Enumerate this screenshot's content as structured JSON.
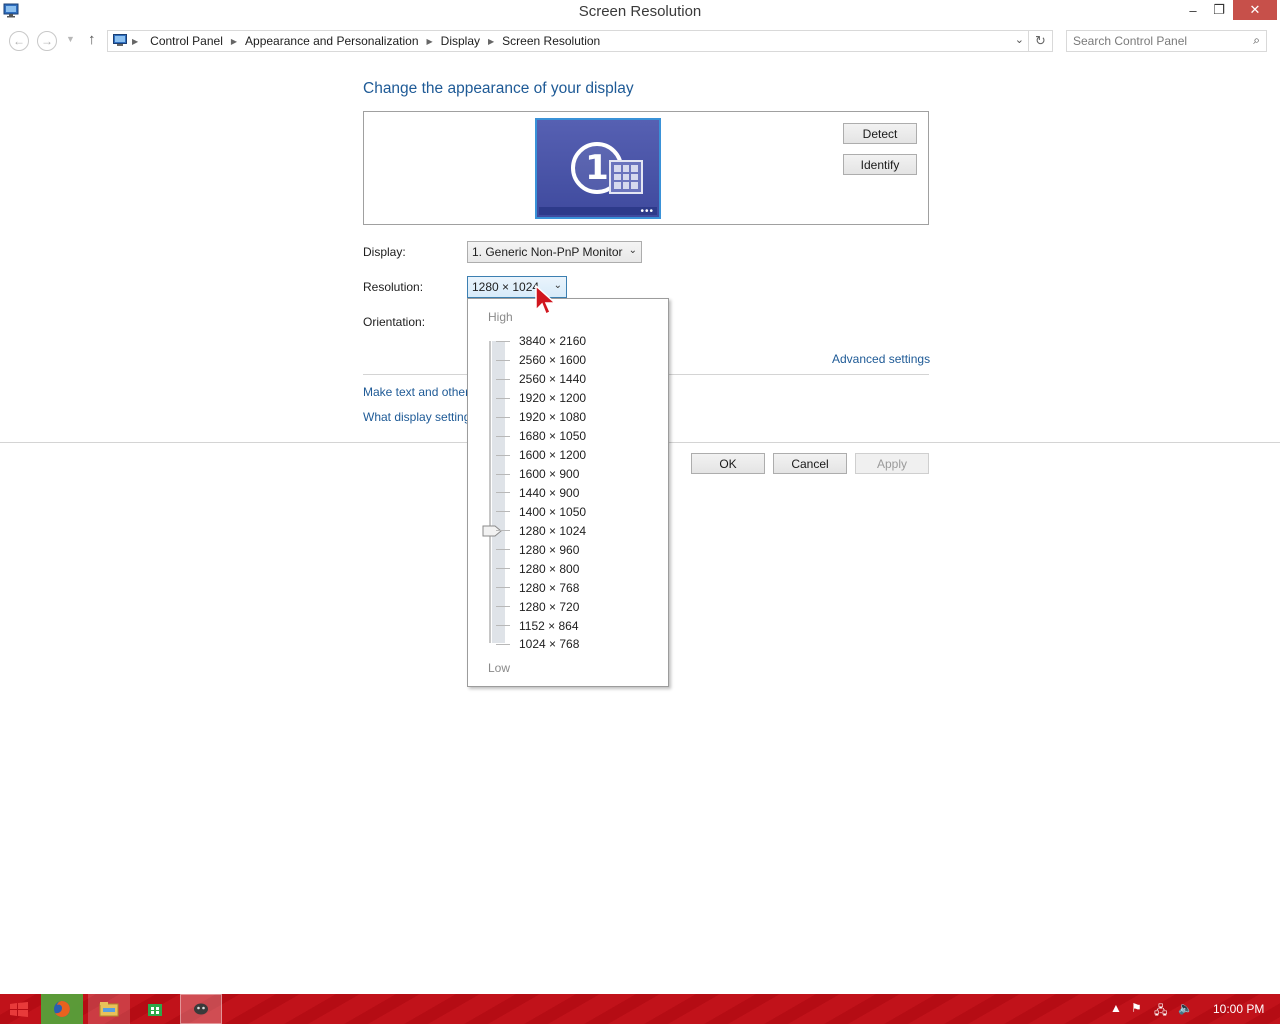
{
  "window": {
    "title": "Screen Resolution",
    "controls": {
      "minimize": "–",
      "maximize": "❐",
      "close": "✕"
    }
  },
  "nav": {
    "breadcrumbs": [
      "Control Panel",
      "Appearance and Personalization",
      "Display",
      "Screen Resolution"
    ],
    "search_placeholder": "Search Control Panel"
  },
  "main": {
    "heading": "Change the appearance of your display",
    "monitor_number": "1",
    "detect_label": "Detect",
    "identify_label": "Identify",
    "display_label": "Display:",
    "display_value": "1. Generic Non-PnP Monitor",
    "resolution_label": "Resolution:",
    "resolution_value": "1280 × 1024",
    "orientation_label": "Orientation:",
    "advanced_link": "Advanced settings",
    "link_text_size": "Make text and other",
    "link_display_settings": "What display setting",
    "ok_label": "OK",
    "cancel_label": "Cancel",
    "apply_label": "Apply"
  },
  "resolution_dropdown": {
    "high_label": "High",
    "low_label": "Low",
    "options": [
      "3840 × 2160",
      "2560 × 1600",
      "2560 × 1440",
      "1920 × 1200",
      "1920 × 1080",
      "1680 × 1050",
      "1600 × 1200",
      "1600 × 900",
      "1440 × 900",
      "1400 × 1050",
      "1280 × 1024",
      "1280 × 960",
      "1280 × 800",
      "1280 × 768",
      "1280 × 720",
      "1152 × 864",
      "1024 × 768"
    ],
    "selected_index": 10
  },
  "taskbar": {
    "clock": "10:00 PM",
    "items": [
      "firefox-icon",
      "file-explorer-icon",
      "store-icon",
      "app-icon"
    ]
  },
  "colors": {
    "accent_link": "#1e5a96",
    "taskbar": "#c1121a",
    "close_button": "#c7504a"
  }
}
